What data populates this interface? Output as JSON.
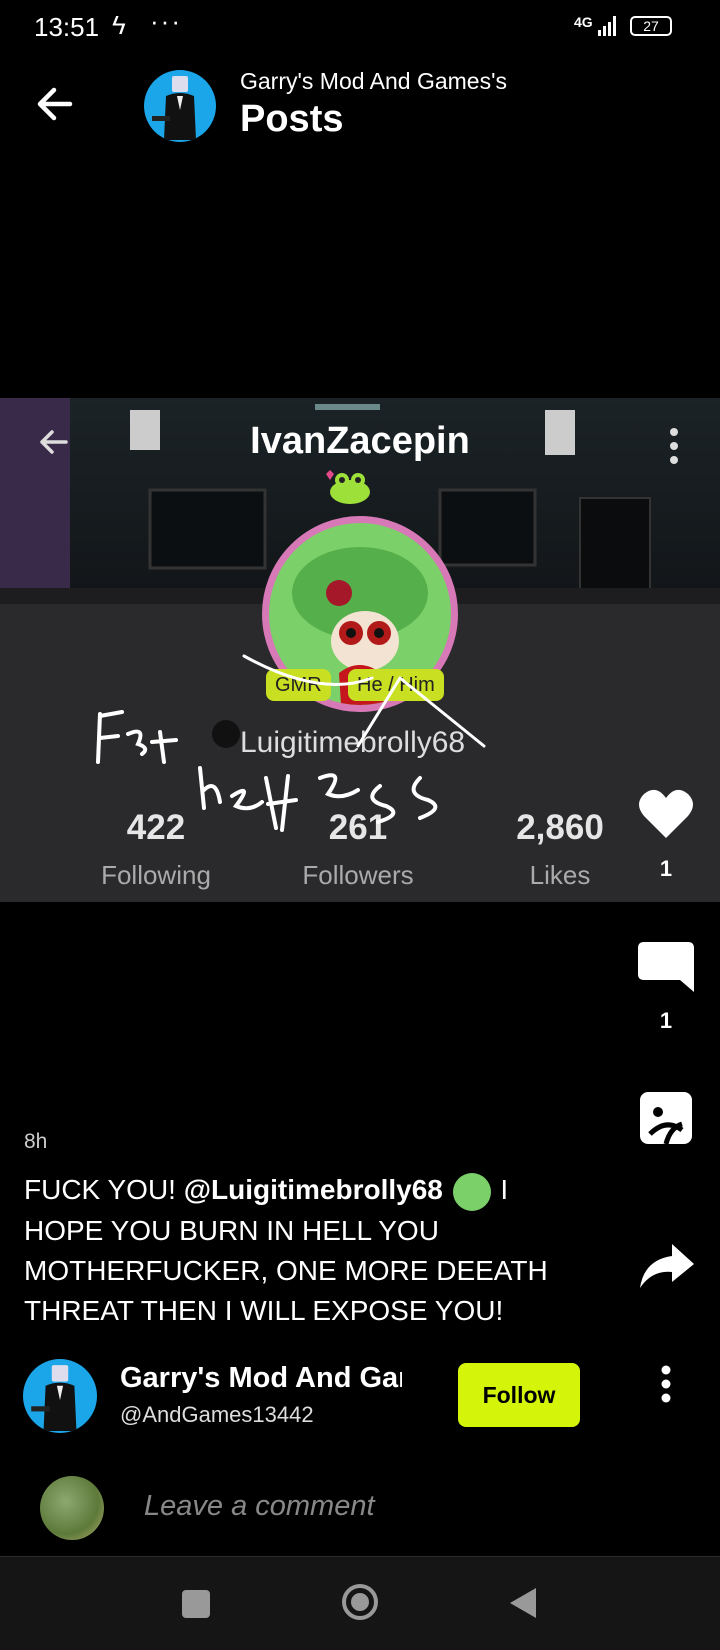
{
  "status_bar": {
    "time": "13:51",
    "bolt": "ϟ",
    "dots": "···",
    "network": "4G",
    "battery": "27"
  },
  "header": {
    "owner": "Garry's Mod And Games's",
    "title": "Posts"
  },
  "screenshot": {
    "username_title": "IvanZacepin",
    "badges": [
      "GMR",
      "He / Him"
    ],
    "handle": "Luigitimebrolly68",
    "stats": [
      {
        "value": "422",
        "label": "Following"
      },
      {
        "value": "261",
        "label": "Followers"
      },
      {
        "value": "2,860",
        "label": "Likes"
      }
    ],
    "scribble_note": "Fatherless"
  },
  "actions": {
    "like_count": "1",
    "comment_count": "1"
  },
  "post": {
    "time": "8h",
    "text_before": "FUCK YOU! ",
    "mention": "@Luigitimebrolly68",
    "text_after": " I HOPE YOU BURN IN HELL YOU MOTHERFUCKER, ONE MORE DEEATH THREAT THEN I WILL EXPOSE YOU!"
  },
  "author": {
    "name": "Garry's Mod And Games",
    "handle": "@AndGames13442",
    "follow_label": "Follow"
  },
  "comment": {
    "placeholder": "Leave a comment"
  },
  "colors": {
    "accent": "#d4f50a",
    "badge": "#c9df22",
    "background": "#000000"
  }
}
